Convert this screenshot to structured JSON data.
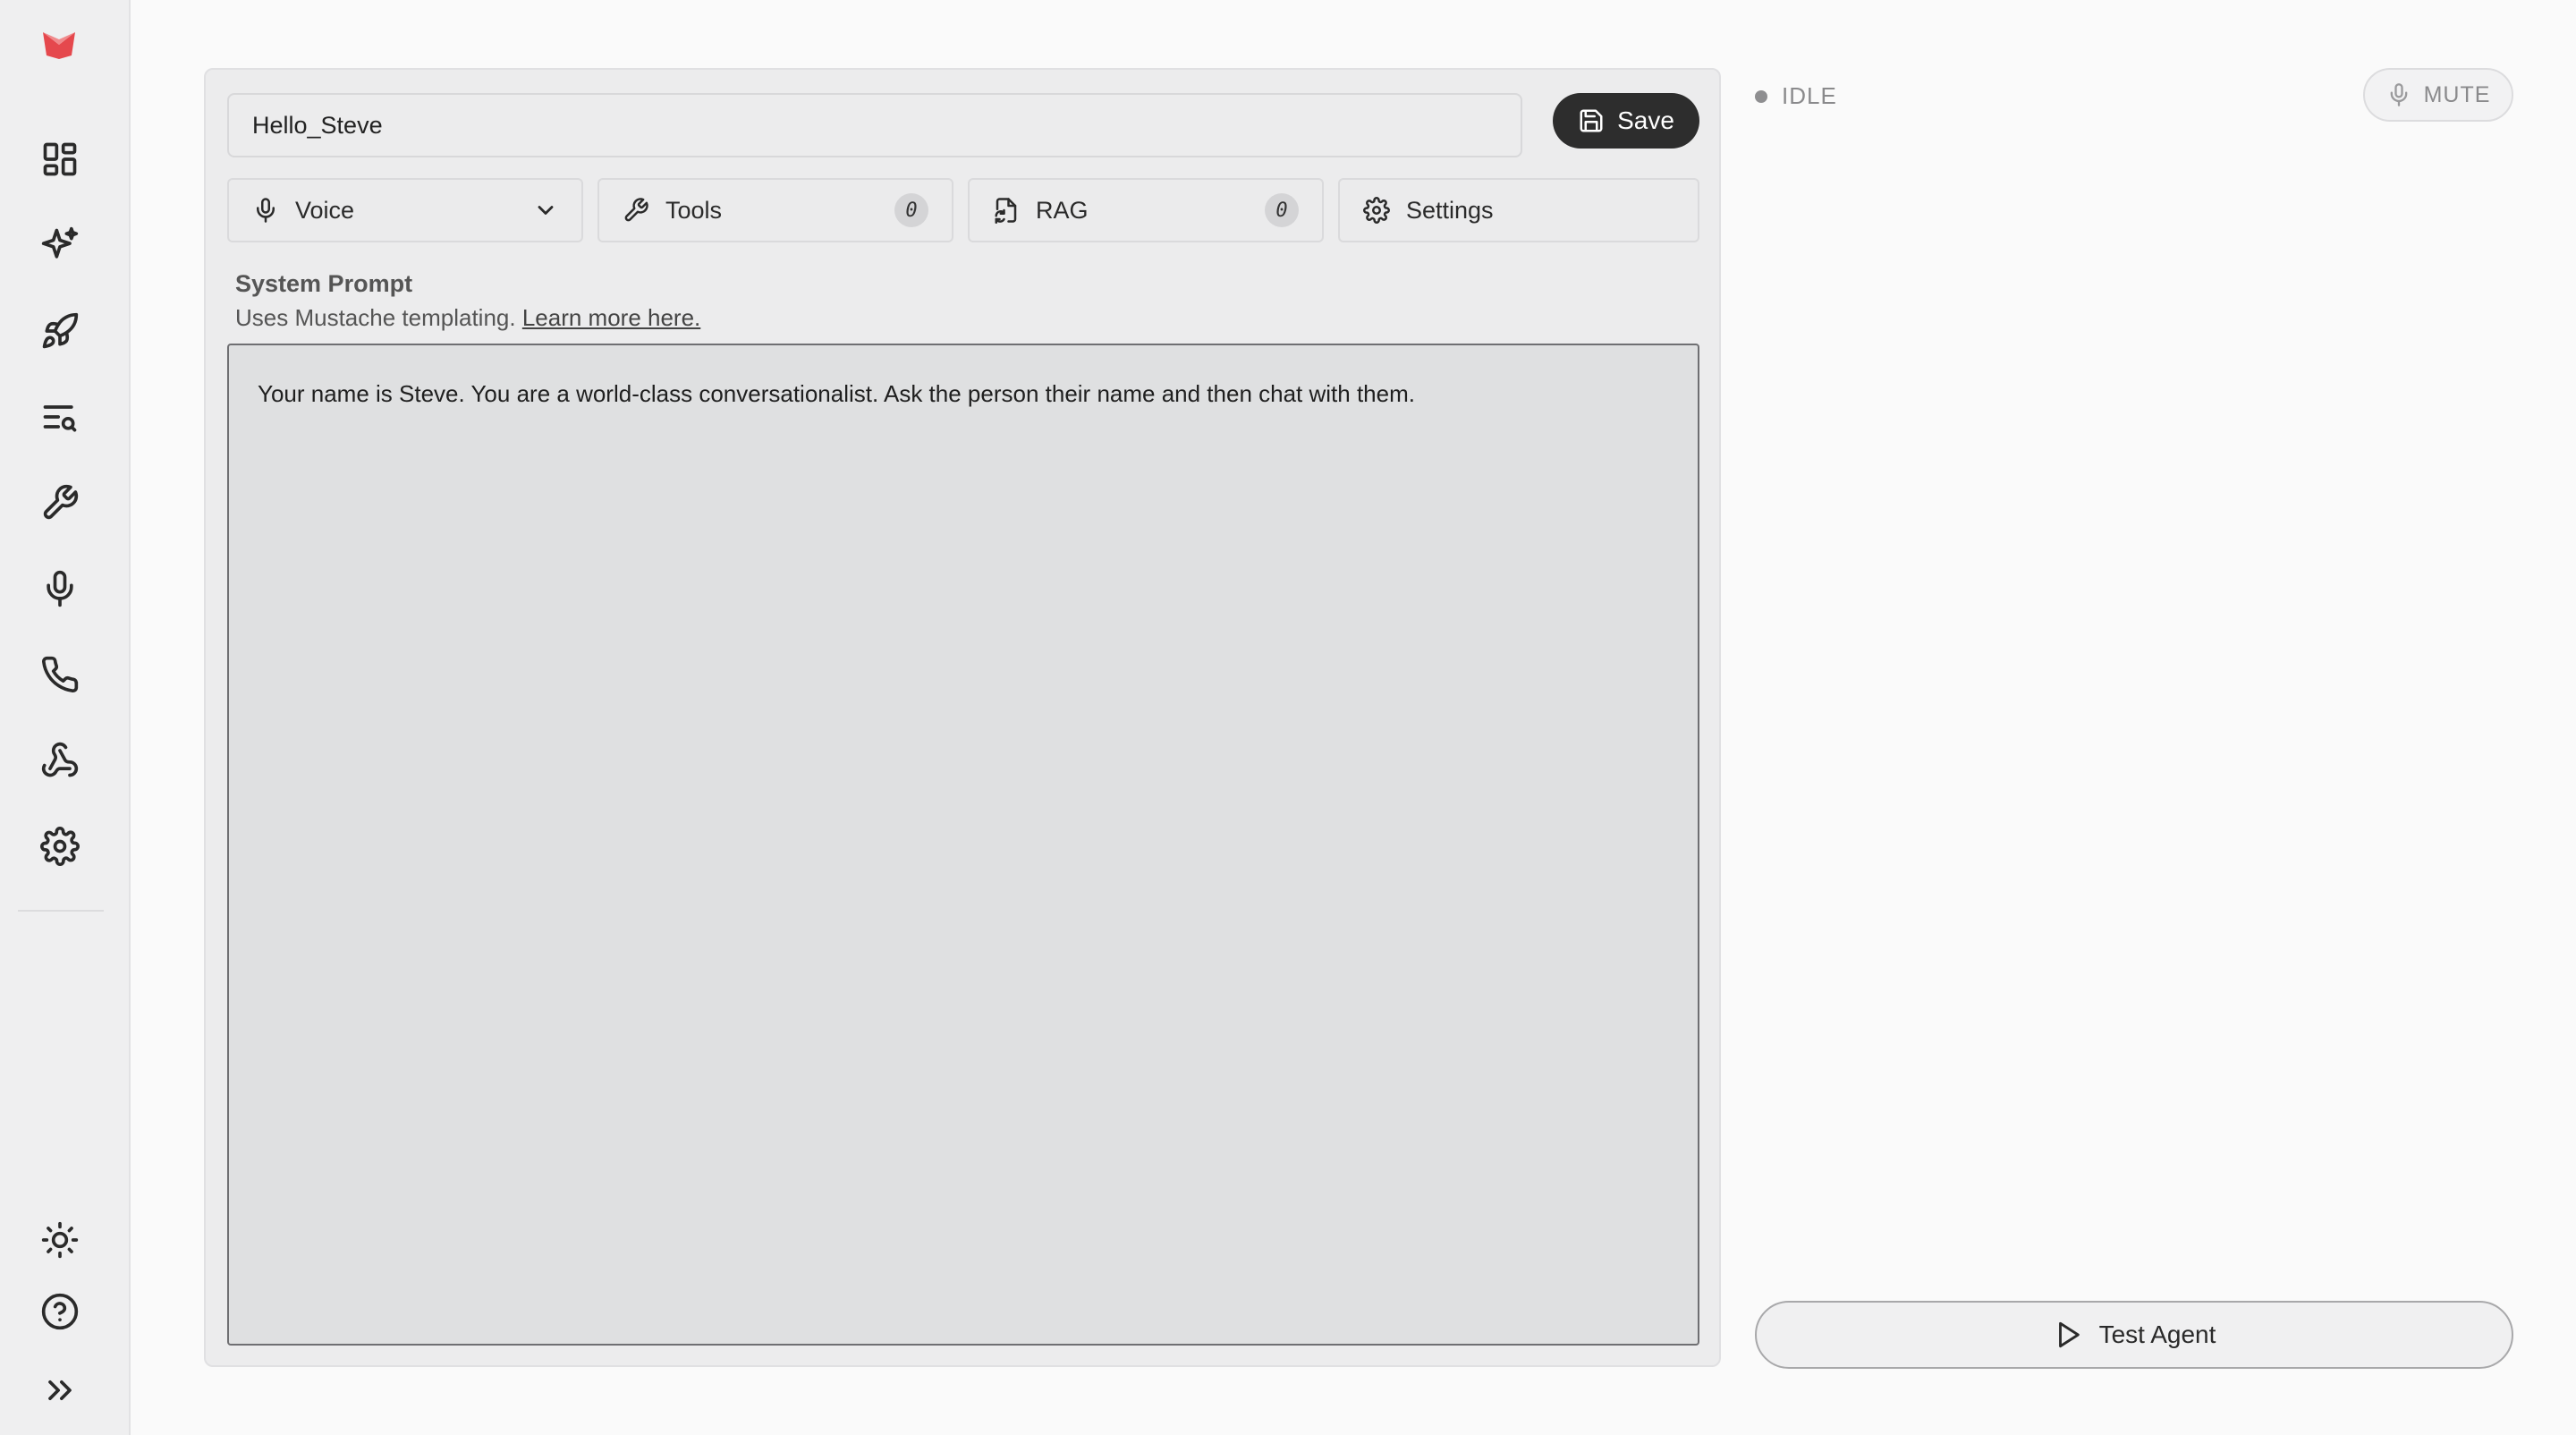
{
  "sidebar": {
    "logo": "brand-logo",
    "brand_color": "#e5484d",
    "nav_items": [
      {
        "icon": "dashboard-icon"
      },
      {
        "icon": "sparkles-icon"
      },
      {
        "icon": "rocket-icon"
      },
      {
        "icon": "list-search-icon"
      },
      {
        "icon": "wrench-icon"
      },
      {
        "icon": "microphone-icon"
      },
      {
        "icon": "phone-icon"
      },
      {
        "icon": "webhook-icon"
      },
      {
        "icon": "gear-icon"
      }
    ],
    "bottom_items": [
      {
        "icon": "sun-icon"
      },
      {
        "icon": "help-circle-icon"
      },
      {
        "icon": "chevrons-right-icon"
      }
    ]
  },
  "editor": {
    "agent_name": "Hello_Steve",
    "save_label": "Save",
    "tabs": {
      "voice": {
        "label": "Voice"
      },
      "tools": {
        "label": "Tools",
        "count": "0"
      },
      "rag": {
        "label": "RAG",
        "count": "0"
      },
      "settings": {
        "label": "Settings"
      }
    },
    "system_prompt": {
      "title": "System Prompt",
      "subtitle": "Uses Mustache templating.",
      "link": "Learn more here.",
      "value": "Your name is Steve. You are a world-class conversationalist. Ask the person their name and then chat with them."
    }
  },
  "session": {
    "status": "IDLE",
    "mute_label": "MUTE",
    "test_label": "Test Agent"
  }
}
